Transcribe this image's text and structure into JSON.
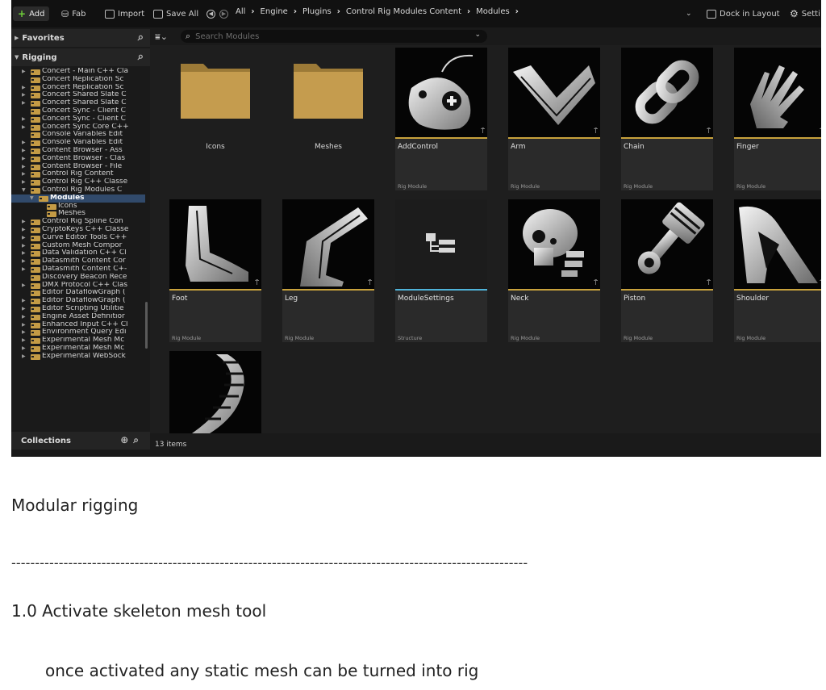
{
  "toolbar": {
    "add_label": "Add",
    "fab_label": "Fab",
    "import_label": "Import",
    "save_all_label": "Save All",
    "breadcrumbs": [
      "All",
      "Engine",
      "Plugins",
      "Control Rig Modules Content",
      "Modules"
    ],
    "dock_label": "Dock in Layout",
    "settings_label": "Setti"
  },
  "sidebar": {
    "favorites_label": "Favorites",
    "rigging_label": "Rigging",
    "collections_label": "Collections",
    "tree": [
      {
        "label": "Concert - Main C++ Cla",
        "indent": 0,
        "arrow": true
      },
      {
        "label": "Concert Replication Sc",
        "indent": 0,
        "arrow": false
      },
      {
        "label": "Concert Replication Sc",
        "indent": 0,
        "arrow": true
      },
      {
        "label": "Concert Shared Slate C",
        "indent": 0,
        "arrow": true
      },
      {
        "label": "Concert Shared Slate C",
        "indent": 0,
        "arrow": true
      },
      {
        "label": "Concert Sync - Client C",
        "indent": 0,
        "arrow": false
      },
      {
        "label": "Concert Sync - Client C",
        "indent": 0,
        "arrow": true
      },
      {
        "label": "Concert Sync Core C++",
        "indent": 0,
        "arrow": true
      },
      {
        "label": "Console Variables Edit",
        "indent": 0,
        "arrow": false
      },
      {
        "label": "Console Variables Edit",
        "indent": 0,
        "arrow": true
      },
      {
        "label": "Content Browser - Ass",
        "indent": 0,
        "arrow": true
      },
      {
        "label": "Content Browser - Clas",
        "indent": 0,
        "arrow": true
      },
      {
        "label": "Content Browser - File",
        "indent": 0,
        "arrow": true
      },
      {
        "label": "Control Rig Content",
        "indent": 0,
        "arrow": true
      },
      {
        "label": "Control Rig C++ Classe",
        "indent": 0,
        "arrow": true
      },
      {
        "label": "Control Rig Modules C",
        "indent": 0,
        "arrow": true,
        "open": true
      },
      {
        "label": "Modules",
        "indent": 1,
        "arrow": true,
        "open": true,
        "selected": true
      },
      {
        "label": "Icons",
        "indent": 2,
        "arrow": false
      },
      {
        "label": "Meshes",
        "indent": 2,
        "arrow": false
      },
      {
        "label": "Control Rig Spline Con",
        "indent": 0,
        "arrow": true
      },
      {
        "label": "CryptoKeys C++ Classe",
        "indent": 0,
        "arrow": true
      },
      {
        "label": "Curve Editor Tools C++",
        "indent": 0,
        "arrow": true
      },
      {
        "label": "Custom Mesh Compor",
        "indent": 0,
        "arrow": true
      },
      {
        "label": "Data Validation C++ Cl",
        "indent": 0,
        "arrow": true
      },
      {
        "label": "Datasmith Content Cor",
        "indent": 0,
        "arrow": true
      },
      {
        "label": "Datasmith Content C+-",
        "indent": 0,
        "arrow": true
      },
      {
        "label": "Discovery Beacon Rece",
        "indent": 0,
        "arrow": false
      },
      {
        "label": "DMX Protocol C++ Clas",
        "indent": 0,
        "arrow": true
      },
      {
        "label": "Editor DataflowGraph (",
        "indent": 0,
        "arrow": false
      },
      {
        "label": "Editor DataflowGraph (",
        "indent": 0,
        "arrow": true
      },
      {
        "label": "Editor Scripting Utilitie",
        "indent": 0,
        "arrow": true
      },
      {
        "label": "Engine Asset Definitior",
        "indent": 0,
        "arrow": true
      },
      {
        "label": "Enhanced Input C++ Cl",
        "indent": 0,
        "arrow": true
      },
      {
        "label": "Environment Query Edi",
        "indent": 0,
        "arrow": true
      },
      {
        "label": "Experimental Mesh Mc",
        "indent": 0,
        "arrow": true
      },
      {
        "label": "Experimental Mesh Mc",
        "indent": 0,
        "arrow": true
      },
      {
        "label": "Experimental WebSock",
        "indent": 0,
        "arrow": true
      }
    ]
  },
  "content": {
    "search_placeholder": "Search Modules",
    "item_count": "13 items",
    "rig_module_type": "Rig Module",
    "structure_type": "Structure",
    "folders": [
      "Icons",
      "Meshes"
    ],
    "tiles": [
      {
        "name": "AddControl",
        "type": "Rig Module"
      },
      {
        "name": "Arm",
        "type": "Rig Module"
      },
      {
        "name": "Chain",
        "type": "Rig Module"
      },
      {
        "name": "Finger",
        "type": "Rig Module"
      },
      {
        "name": "Foot",
        "type": "Rig Module"
      },
      {
        "name": "Leg",
        "type": "Rig Module"
      },
      {
        "name": "ModuleSettings",
        "type": "Structure"
      },
      {
        "name": "Neck",
        "type": "Rig Module"
      },
      {
        "name": "Piston",
        "type": "Rig Module"
      },
      {
        "name": "Shoulder",
        "type": "Rig Module"
      }
    ]
  },
  "colors": {
    "rig_module_bar": "#c8a23c",
    "structure_bar": "#4fb3d9",
    "folder": "#c49b45",
    "selected_row": "#314a6b"
  },
  "notes": {
    "heading": "Modular rigging",
    "divider": "-------------------------------------------------------------------------------------------------------------",
    "step": "1.0 Activate skeleton mesh tool",
    "detail": "once activated any static mesh can be turned into rig"
  }
}
